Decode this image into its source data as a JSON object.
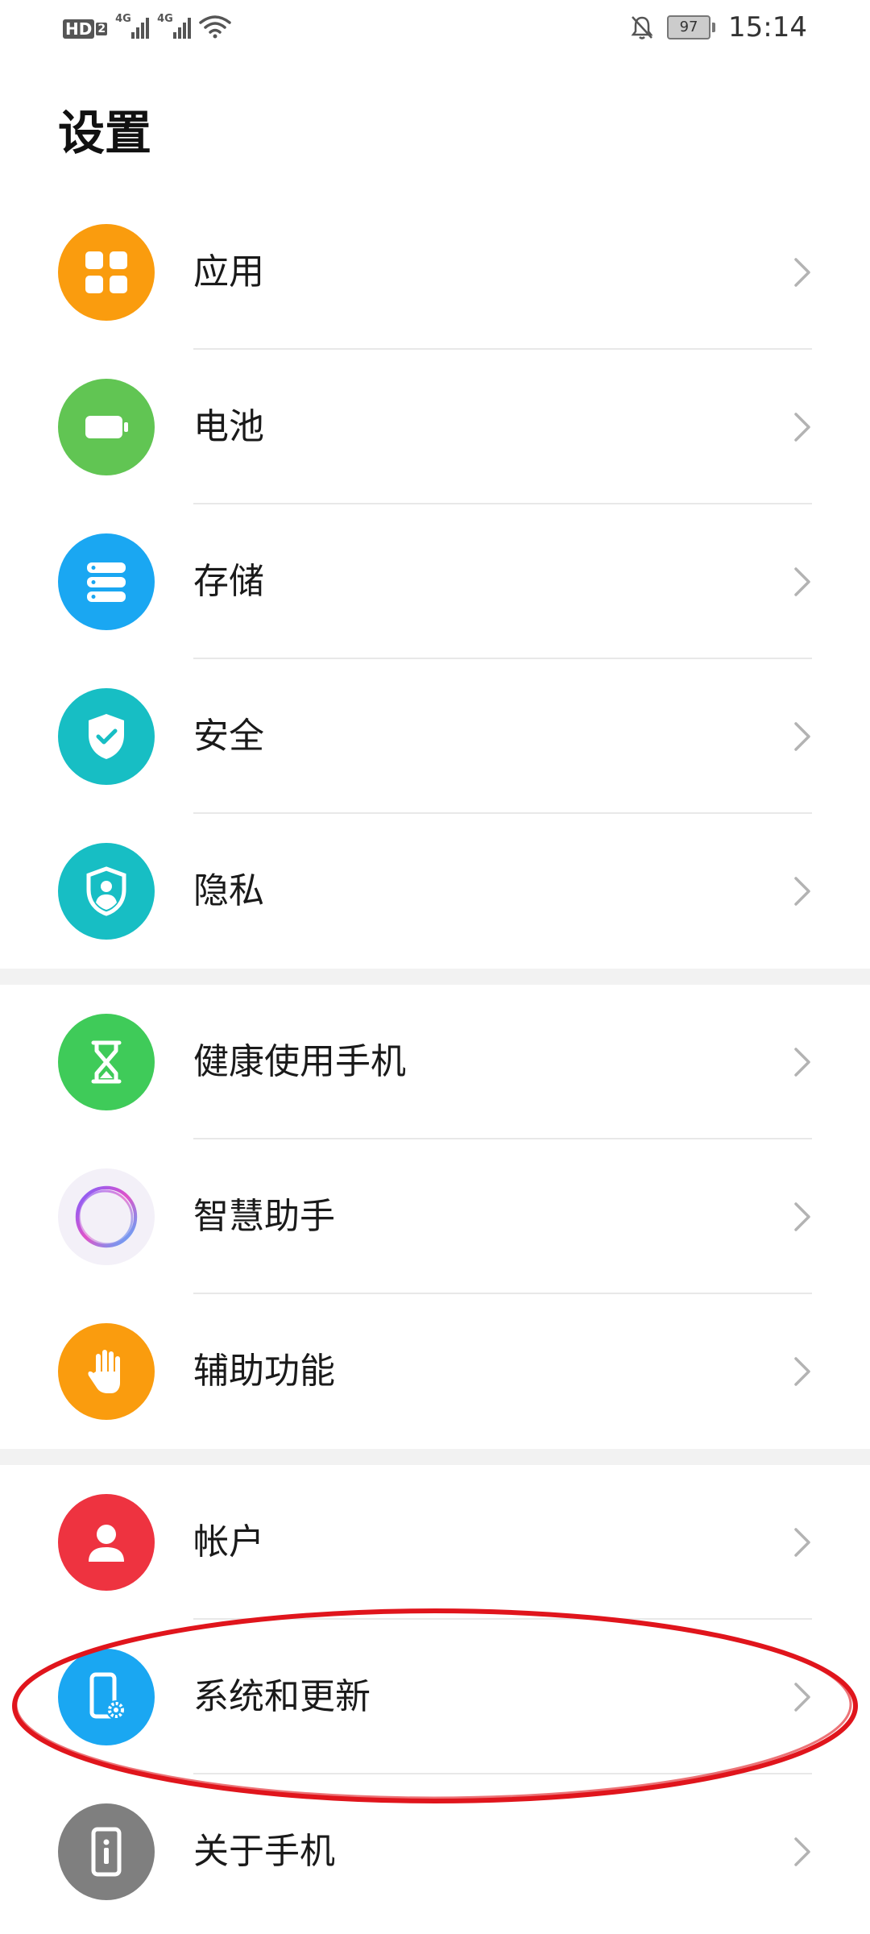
{
  "status_bar": {
    "hd_label": "HD",
    "hd_sub": "2",
    "net1": "4G",
    "net2": "4G",
    "battery": "97",
    "time": "15:14"
  },
  "page": {
    "title": "设置"
  },
  "groups": [
    {
      "items": [
        {
          "label": "应用",
          "icon": "apps-icon",
          "color": "#FA9C0E"
        },
        {
          "label": "电池",
          "icon": "battery-icon",
          "color": "#61C553"
        },
        {
          "label": "存储",
          "icon": "storage-icon",
          "color": "#1AA7F2"
        },
        {
          "label": "安全",
          "icon": "shield-check-icon",
          "color": "#17BEC4"
        },
        {
          "label": "隐私",
          "icon": "privacy-icon",
          "color": "#17BEC4"
        }
      ]
    },
    {
      "items": [
        {
          "label": "健康使用手机",
          "icon": "hourglass-icon",
          "color": "#3FCB59"
        },
        {
          "label": "智慧助手",
          "icon": "assistant-orb-icon",
          "color": "#F3F0F8"
        },
        {
          "label": "辅助功能",
          "icon": "hand-icon",
          "color": "#FA9C0E"
        }
      ]
    },
    {
      "items": [
        {
          "label": "帐户",
          "icon": "user-icon",
          "color": "#EE3340"
        },
        {
          "label": "系统和更新",
          "icon": "system-update-icon",
          "color": "#1AA7F2"
        },
        {
          "label": "关于手机",
          "icon": "phone-info-icon",
          "color": "#7F7F7F"
        }
      ]
    }
  ],
  "annotation": {
    "color": "#E0151C"
  }
}
